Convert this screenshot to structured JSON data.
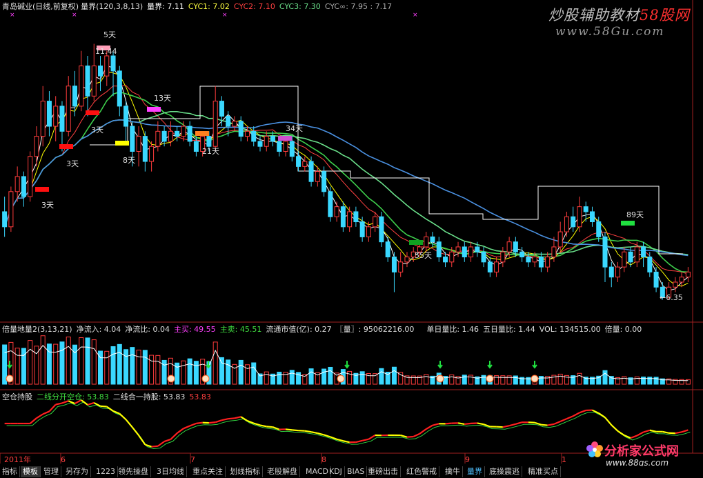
{
  "header": {
    "stock": "青岛碱业(日线,前复权)",
    "indicator": "量界(120,3,8,13)",
    "liangjie": "量界: 7.11",
    "cyc1": "CYC1: 7.02",
    "cyc2": "CYC2: 7.10",
    "cyc3": "CYC3: 7.30",
    "cycinf": "CYC∞: 7.95 : 7.17"
  },
  "watermark": {
    "text": "炒股辅助教材",
    "red": "58股网",
    "url": "www.58Gu.com"
  },
  "panel2": {
    "name": "倍量地量2(3,13,21)",
    "f1": "净流入: 4.04",
    "f2": "净流比: 0.04",
    "f3": "主买: 49.55",
    "f4": "主卖: 45.51",
    "f5": "流通市值(亿): 0.27",
    "f6": "〖量〗: 95062216.00",
    "f7": "单日量比: 1.46",
    "f8": "五日量比: 1.44",
    "f9": "VOL: 134515.00",
    "f10": "倍量: 0.00"
  },
  "panel3": {
    "name": "空仓持股",
    "f1": "二线分开空仓: 53.83",
    "f2": "二线合一持股: 53.83",
    "f3": "53.83"
  },
  "annotations": {
    "peak_label": "11.44",
    "low_label": "6.35",
    "days": [
      "5天",
      "13天",
      "3天",
      "3天",
      "3天",
      "8天",
      "21天",
      "34天",
      "55天",
      "89天"
    ]
  },
  "xaxis": {
    "year": "2011年",
    "months": [
      "6",
      "7",
      "8",
      "9",
      "1"
    ]
  },
  "tabs": [
    "指标",
    "模板",
    "管理",
    "另存为",
    "1223",
    "领先操盘",
    "3日均线",
    "重点关注",
    "划线指标",
    "老股解盘",
    "MACD",
    "KDJ",
    "BIAS",
    "重磅出击",
    "红色警戒",
    "擒牛",
    "量界",
    "底操震逃",
    "精准买点"
  ],
  "logo": {
    "title": "分析家公式网",
    "url": "www.88gs.com"
  },
  "colors": {
    "up": "#ff3c3c",
    "down": "#3ad8ff",
    "ma_white": "#ffffff",
    "ma_yellow": "#ffff00",
    "ma_green": "#3ecf4c",
    "ma_lightgreen": "#6adf8a"
  },
  "chart_data": {
    "type": "candlestick",
    "price_range": [
      6.0,
      11.9
    ],
    "candles": [
      [
        8.1,
        7.8,
        8.4,
        7.6
      ],
      [
        7.8,
        8.5,
        8.6,
        7.7
      ],
      [
        8.5,
        8.8,
        9.0,
        8.3
      ],
      [
        8.8,
        8.4,
        8.9,
        8.2
      ],
      [
        8.4,
        9.2,
        9.3,
        8.3
      ],
      [
        9.2,
        9.6,
        9.8,
        9.0
      ],
      [
        9.6,
        10.3,
        10.6,
        9.4
      ],
      [
        10.3,
        9.8,
        10.5,
        9.6
      ],
      [
        9.8,
        10.2,
        10.4,
        9.5
      ],
      [
        10.2,
        9.7,
        10.3,
        9.3
      ],
      [
        9.7,
        10.6,
        10.8,
        9.6
      ],
      [
        10.6,
        10.2,
        10.9,
        10.0
      ],
      [
        10.2,
        11.0,
        11.3,
        10.1
      ],
      [
        11.0,
        10.4,
        11.2,
        10.0
      ],
      [
        10.4,
        11.0,
        11.44,
        10.3
      ],
      [
        11.0,
        10.8,
        11.2,
        10.5
      ],
      [
        10.8,
        11.2,
        11.3,
        10.6
      ],
      [
        11.2,
        10.9,
        11.3,
        10.4
      ],
      [
        10.9,
        10.2,
        11.0,
        10.0
      ],
      [
        10.2,
        9.8,
        10.3,
        9.5
      ],
      [
        9.8,
        9.3,
        9.9,
        9.0
      ],
      [
        9.3,
        9.6,
        9.8,
        9.0
      ],
      [
        9.6,
        9.1,
        9.7,
        8.9
      ],
      [
        9.1,
        9.4,
        9.5,
        8.9
      ],
      [
        9.4,
        9.7,
        9.9,
        9.3
      ],
      [
        9.7,
        9.5,
        9.8,
        9.4
      ],
      [
        9.5,
        9.7,
        9.9,
        9.4
      ],
      [
        9.7,
        9.6,
        9.8,
        9.5
      ],
      [
        9.6,
        9.8,
        9.9,
        9.5
      ],
      [
        9.8,
        9.5,
        9.9,
        9.4
      ],
      [
        9.5,
        9.3,
        9.6,
        9.2
      ],
      [
        9.3,
        9.6,
        9.7,
        9.2
      ],
      [
        9.6,
        9.4,
        9.7,
        9.3
      ],
      [
        9.4,
        10.3,
        10.6,
        9.3
      ],
      [
        10.3,
        10.0,
        10.4,
        9.8
      ],
      [
        10.0,
        9.8,
        10.1,
        9.6
      ],
      [
        9.8,
        9.9,
        10.0,
        9.7
      ],
      [
        9.9,
        9.6,
        10.0,
        9.5
      ],
      [
        9.6,
        9.7,
        9.8,
        9.5
      ],
      [
        9.7,
        9.5,
        9.8,
        9.4
      ],
      [
        9.5,
        9.4,
        9.6,
        9.3
      ],
      [
        9.4,
        9.6,
        9.7,
        9.3
      ],
      [
        9.6,
        9.5,
        9.7,
        9.4
      ],
      [
        9.5,
        9.3,
        9.6,
        9.2
      ],
      [
        9.3,
        9.5,
        9.6,
        9.2
      ],
      [
        9.5,
        9.2,
        9.6,
        9.1
      ],
      [
        9.2,
        9.0,
        9.3,
        8.9
      ],
      [
        9.0,
        9.1,
        9.2,
        8.9
      ],
      [
        9.1,
        8.7,
        9.2,
        8.6
      ],
      [
        8.7,
        8.9,
        9.0,
        8.6
      ],
      [
        8.9,
        8.5,
        9.0,
        8.4
      ],
      [
        8.5,
        8.0,
        8.6,
        7.9
      ],
      [
        8.0,
        8.2,
        8.3,
        7.9
      ],
      [
        8.2,
        7.8,
        8.3,
        7.7
      ],
      [
        7.8,
        8.1,
        8.2,
        7.7
      ],
      [
        8.1,
        7.9,
        8.2,
        7.8
      ],
      [
        7.9,
        7.6,
        8.0,
        7.5
      ],
      [
        7.6,
        7.8,
        7.9,
        7.5
      ],
      [
        7.8,
        8.0,
        8.1,
        7.7
      ],
      [
        8.0,
        7.5,
        8.1,
        7.4
      ],
      [
        7.5,
        7.2,
        7.6,
        7.1
      ],
      [
        7.2,
        6.9,
        7.3,
        6.5
      ],
      [
        6.9,
        7.1,
        7.3,
        6.8
      ],
      [
        7.1,
        7.2,
        7.3,
        7.0
      ],
      [
        7.2,
        7.3,
        7.4,
        7.1
      ],
      [
        7.3,
        7.4,
        7.5,
        7.2
      ],
      [
        7.4,
        7.6,
        7.7,
        7.3
      ],
      [
        7.6,
        7.5,
        7.7,
        7.4
      ],
      [
        7.5,
        7.2,
        7.6,
        7.1
      ],
      [
        7.2,
        7.1,
        7.3,
        7.0
      ],
      [
        7.1,
        7.3,
        7.4,
        7.0
      ],
      [
        7.3,
        7.4,
        7.5,
        7.2
      ],
      [
        7.4,
        7.2,
        7.5,
        7.1
      ],
      [
        7.2,
        7.4,
        7.5,
        7.1
      ],
      [
        7.4,
        7.3,
        7.5,
        7.2
      ],
      [
        7.3,
        7.1,
        7.4,
        7.0
      ],
      [
        7.1,
        6.9,
        7.2,
        6.8
      ],
      [
        6.9,
        7.1,
        7.2,
        6.8
      ],
      [
        7.1,
        7.3,
        7.4,
        7.0
      ],
      [
        7.3,
        7.5,
        7.6,
        7.2
      ],
      [
        7.5,
        7.3,
        7.6,
        7.2
      ],
      [
        7.3,
        7.2,
        7.4,
        7.1
      ],
      [
        7.2,
        7.1,
        7.3,
        7.0
      ],
      [
        7.1,
        7.2,
        7.3,
        7.0
      ],
      [
        7.2,
        7.0,
        7.3,
        6.9
      ],
      [
        7.0,
        7.2,
        7.3,
        6.9
      ],
      [
        7.2,
        7.4,
        7.6,
        7.1
      ],
      [
        7.4,
        7.7,
        7.9,
        7.3
      ],
      [
        7.7,
        8.0,
        8.1,
        7.6
      ],
      [
        8.0,
        7.8,
        8.2,
        7.7
      ],
      [
        7.8,
        8.2,
        8.4,
        7.7
      ],
      [
        8.2,
        8.1,
        8.3,
        7.9
      ],
      [
        8.1,
        7.9,
        8.2,
        7.8
      ],
      [
        7.9,
        7.6,
        8.0,
        7.5
      ],
      [
        7.6,
        7.0,
        7.7,
        6.7
      ],
      [
        7.0,
        6.8,
        7.1,
        6.6
      ],
      [
        6.8,
        7.0,
        7.1,
        6.7
      ],
      [
        7.0,
        7.3,
        7.4,
        6.9
      ],
      [
        7.3,
        7.1,
        7.4,
        7.0
      ],
      [
        7.1,
        7.4,
        7.5,
        7.0
      ],
      [
        7.4,
        7.2,
        7.5,
        7.0
      ],
      [
        7.2,
        6.9,
        7.3,
        6.8
      ],
      [
        6.9,
        6.6,
        7.0,
        6.5
      ],
      [
        6.6,
        6.4,
        6.7,
        6.35
      ],
      [
        6.4,
        6.6,
        6.7,
        6.35
      ],
      [
        6.6,
        6.7,
        6.8,
        6.5
      ],
      [
        6.7,
        6.8,
        6.9,
        6.6
      ],
      [
        6.8,
        6.9,
        7.0,
        6.7
      ]
    ]
  }
}
